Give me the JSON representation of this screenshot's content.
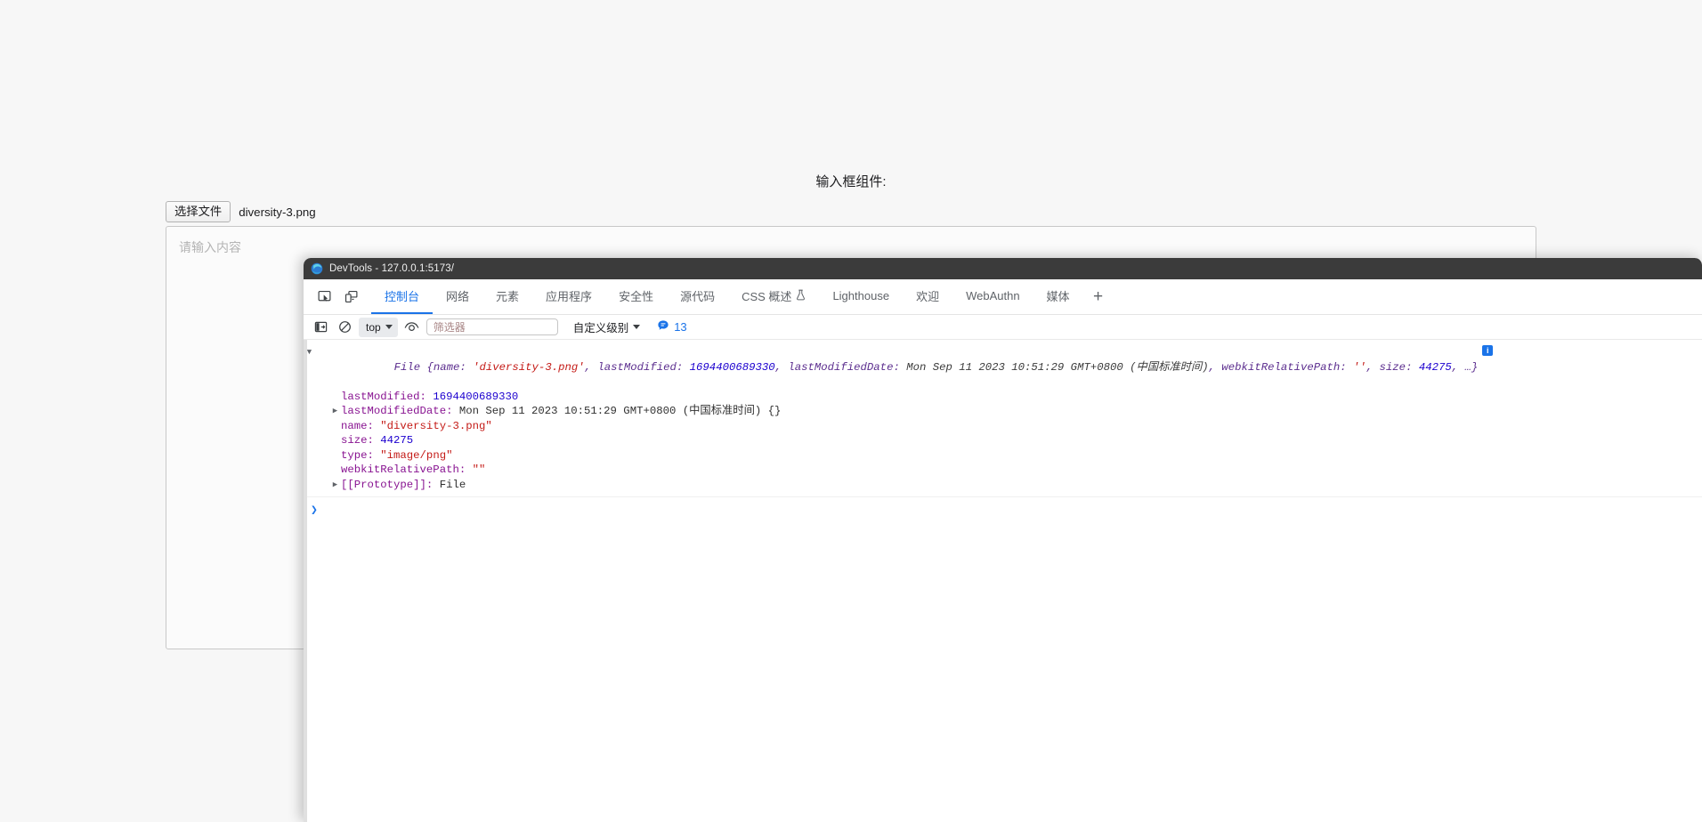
{
  "page": {
    "heading": "输入框组件:",
    "file_input": {
      "button_label": "选择文件",
      "file_name": "diversity-3.png"
    },
    "textarea": {
      "placeholder": "请输入内容",
      "value": ""
    }
  },
  "devtools": {
    "window_title": "DevTools - 127.0.0.1:5173/",
    "icons": {
      "inspect": "inspect-element-icon",
      "device": "device-toolbar-icon",
      "edge_logo": "edge-logo-icon"
    },
    "tabs": [
      {
        "label": "控制台",
        "active": true
      },
      {
        "label": "网络",
        "active": false
      },
      {
        "label": "元素",
        "active": false
      },
      {
        "label": "应用程序",
        "active": false
      },
      {
        "label": "安全性",
        "active": false
      },
      {
        "label": "源代码",
        "active": false
      },
      {
        "label": "CSS 概述",
        "active": false,
        "icon": "flask-icon"
      },
      {
        "label": "Lighthouse",
        "active": false
      },
      {
        "label": "欢迎",
        "active": false
      },
      {
        "label": "WebAuthn",
        "active": false
      },
      {
        "label": "媒体",
        "active": false
      }
    ],
    "add_tab_label": "+",
    "toolbar": {
      "sidebar_toggle": "console-sidebar-icon",
      "clear_console": "clear-console-icon",
      "context": "top",
      "eye_icon": "live-expression-icon",
      "filter_placeholder": "筛选器",
      "filter_value": "",
      "level_label": "自定义级别",
      "info_count": "13"
    },
    "console": {
      "header": {
        "type": "File ",
        "open_brace": "{",
        "k_name": "name: ",
        "v_name": "'diversity-3.png'",
        "sep1": ", ",
        "k_lastmod": "lastModified: ",
        "v_lastmod": "1694400689330",
        "sep2": ", ",
        "k_lastmoddate": "lastModifiedDate: ",
        "v_lastmoddate": "Mon Sep 11 2023 10:51:29 GMT+0800 (中国标准时间)",
        "sep3": ", ",
        "k_wkrp": "webkitRelativePath: ",
        "v_wkrp": "''",
        "sep4": ", ",
        "k_size": "size: ",
        "v_size": "44275",
        "tail": ", …}",
        "info_glyph": "i"
      },
      "properties": [
        {
          "arrow": false,
          "key": "lastModified: ",
          "value": "1694400689330",
          "value_kind": "num"
        },
        {
          "arrow": true,
          "key": "lastModifiedDate: ",
          "value": "Mon Sep 11 2023 10:51:29 GMT+0800 (中国标准时间) {}",
          "value_kind": "plain"
        },
        {
          "arrow": false,
          "key": "name: ",
          "value": "\"diversity-3.png\"",
          "value_kind": "str"
        },
        {
          "arrow": false,
          "key": "size: ",
          "value": "44275",
          "value_kind": "num"
        },
        {
          "arrow": false,
          "key": "type: ",
          "value": "\"image/png\"",
          "value_kind": "str"
        },
        {
          "arrow": false,
          "key": "webkitRelativePath: ",
          "value": "\"\"",
          "value_kind": "str"
        },
        {
          "arrow": true,
          "key": "[[Prototype]]: ",
          "value": "File",
          "value_kind": "plain",
          "internal": true
        }
      ],
      "prompt_caret": "❯",
      "prompt_value": ""
    }
  }
}
